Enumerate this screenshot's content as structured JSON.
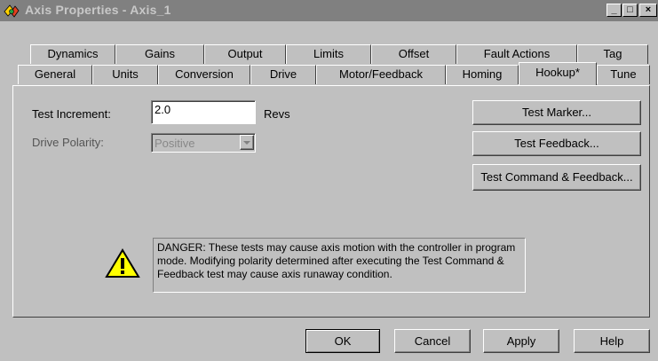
{
  "window": {
    "title": "Axis Properties - Axis_1",
    "controls": {
      "minimize": "_",
      "maximize": "□",
      "close": "×"
    }
  },
  "tabs": {
    "back_row": [
      "Dynamics",
      "Gains",
      "Output",
      "Limits",
      "Offset",
      "Fault Actions",
      "Tag"
    ],
    "front_row": [
      "General",
      "Units",
      "Conversion",
      "Drive",
      "Motor/Feedback",
      "Homing",
      "Hookup*",
      "Tune"
    ],
    "active": "Hookup*"
  },
  "form": {
    "test_increment": {
      "label": "Test Increment:",
      "value": "2.0",
      "unit": "Revs"
    },
    "drive_polarity": {
      "label": "Drive Polarity:",
      "value": "Positive"
    }
  },
  "buttons": {
    "test_marker": "Test Marker...",
    "test_feedback": "Test Feedback...",
    "test_command_feedback": "Test Command & Feedback...",
    "ok": "OK",
    "cancel": "Cancel",
    "apply": "Apply",
    "help": "Help"
  },
  "warning": {
    "icon": "warning-icon",
    "text": "DANGER: These tests may cause axis motion with the controller in program mode. Modifying polarity determined after executing the Test Command & Feedback test may cause axis runaway condition."
  },
  "colors": {
    "titlebar": "#808080",
    "face": "#c0c0c0",
    "warning_yellow": "#ffff00"
  }
}
